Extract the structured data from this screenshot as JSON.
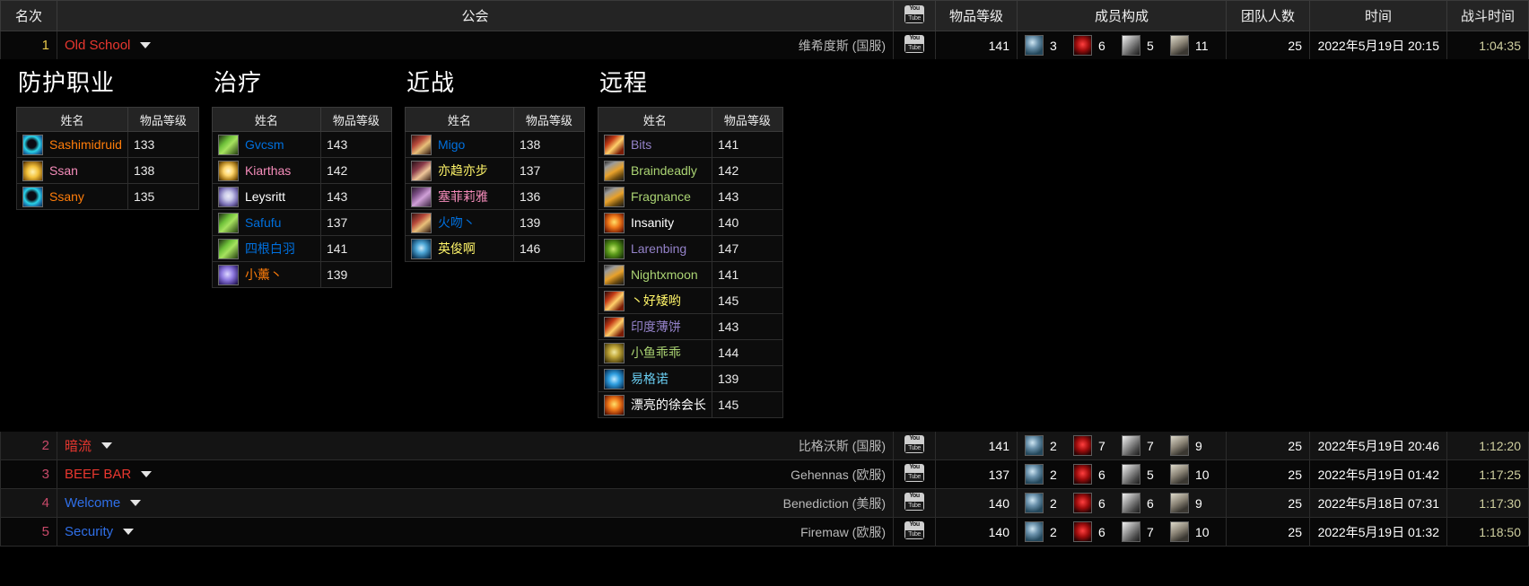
{
  "table": {
    "headers": {
      "rank": "名次",
      "guild": "公会",
      "youtube": "youtube-icon",
      "ilvl": "物品等级",
      "composition": "成员构成",
      "raid_size": "团队人数",
      "date": "时间",
      "duration": "战斗时间"
    },
    "rows": [
      {
        "rank": "1",
        "rank_color": "#e8c84a",
        "guild": "Old School",
        "guild_color": "#e8372f",
        "realm": "维希度斯 (国服)",
        "ilvl": "141",
        "comp": {
          "tank": "3",
          "healer": "6",
          "melee": "5",
          "ranged": "11"
        },
        "raid_size": "25",
        "date": "2022年5月19日 20:15",
        "duration": "1:04:35",
        "expanded": true
      },
      {
        "rank": "2",
        "rank_color": "#c94a6a",
        "guild": "暗流",
        "guild_color": "#e8372f",
        "realm": "比格沃斯 (国服)",
        "ilvl": "141",
        "comp": {
          "tank": "2",
          "healer": "7",
          "melee": "7",
          "ranged": "9"
        },
        "raid_size": "25",
        "date": "2022年5月19日 20:46",
        "duration": "1:12:20",
        "expanded": false
      },
      {
        "rank": "3",
        "rank_color": "#c94a6a",
        "guild": "BEEF BAR",
        "guild_color": "#e8372f",
        "realm": "Gehennas (欧服)",
        "ilvl": "137",
        "comp": {
          "tank": "2",
          "healer": "6",
          "melee": "5",
          "ranged": "10"
        },
        "raid_size": "25",
        "date": "2022年5月19日 01:42",
        "duration": "1:17:25",
        "expanded": false
      },
      {
        "rank": "4",
        "rank_color": "#c94a6a",
        "guild": "Welcome",
        "guild_color": "#2f6fe8",
        "realm": "Benediction (美服)",
        "ilvl": "140",
        "comp": {
          "tank": "2",
          "healer": "6",
          "melee": "6",
          "ranged": "9"
        },
        "raid_size": "25",
        "date": "2022年5月18日 07:31",
        "duration": "1:17:30",
        "expanded": false
      },
      {
        "rank": "5",
        "rank_color": "#c94a6a",
        "guild": "Security",
        "guild_color": "#2f6fe8",
        "realm": "Firemaw (欧服)",
        "ilvl": "140",
        "comp": {
          "tank": "2",
          "healer": "6",
          "melee": "7",
          "ranged": "10"
        },
        "raid_size": "25",
        "date": "2022年5月19日 01:32",
        "duration": "1:18:50",
        "expanded": false
      }
    ]
  },
  "roster": {
    "col_name": "姓名",
    "col_ilvl": "物品等级",
    "groups": [
      {
        "title": "防护职业",
        "members": [
          {
            "name": "Sashimidruid",
            "ilvl": "133",
            "cls": "druid",
            "icon": "druid"
          },
          {
            "name": "Ssan",
            "ilvl": "138",
            "cls": "pala",
            "icon": "pala"
          },
          {
            "name": "Ssany",
            "ilvl": "135",
            "cls": "druid",
            "icon": "druid"
          }
        ]
      },
      {
        "title": "治疗",
        "members": [
          {
            "name": "Gvcsm",
            "ilvl": "143",
            "cls": "shaman",
            "icon": "resto"
          },
          {
            "name": "Kiarthas",
            "ilvl": "142",
            "cls": "pala",
            "icon": "holy"
          },
          {
            "name": "Leysritt",
            "ilvl": "143",
            "cls": "priest",
            "icon": "disc"
          },
          {
            "name": "Safufu",
            "ilvl": "137",
            "cls": "shaman",
            "icon": "resto"
          },
          {
            "name": "四根白羽",
            "ilvl": "141",
            "cls": "shaman",
            "icon": "resto"
          },
          {
            "name": "小薰丶",
            "ilvl": "139",
            "cls": "druid",
            "icon": "shaman"
          }
        ]
      },
      {
        "title": "近战",
        "members": [
          {
            "name": "Migo",
            "ilvl": "138",
            "cls": "shaman",
            "icon": "warr"
          },
          {
            "name": "亦趋亦步",
            "ilvl": "137",
            "cls": "rogue",
            "icon": "fury"
          },
          {
            "name": "塞菲莉雅",
            "ilvl": "136",
            "cls": "pala",
            "icon": "rogue"
          },
          {
            "name": "火吻丶",
            "ilvl": "139",
            "cls": "shaman",
            "icon": "warr"
          },
          {
            "name": "英俊啊",
            "ilvl": "146",
            "cls": "rogue",
            "icon": "dk"
          }
        ]
      },
      {
        "title": "远程",
        "members": [
          {
            "name": "Bits",
            "ilvl": "141",
            "cls": "warl",
            "icon": "mage"
          },
          {
            "name": "Braindeadly",
            "ilvl": "142",
            "cls": "hunt",
            "icon": "warl"
          },
          {
            "name": "Fragnance",
            "ilvl": "143",
            "cls": "hunt",
            "icon": "warl"
          },
          {
            "name": "Insanity",
            "ilvl": "140",
            "cls": "priest",
            "icon": "priest"
          },
          {
            "name": "Larenbing",
            "ilvl": "147",
            "cls": "warl",
            "icon": "hunt"
          },
          {
            "name": "Nightxmoon",
            "ilvl": "141",
            "cls": "hunt",
            "icon": "warl"
          },
          {
            "name": "丶好矮哟",
            "ilvl": "145",
            "cls": "rogue",
            "icon": "mage"
          },
          {
            "name": "印度薄饼",
            "ilvl": "143",
            "cls": "warl",
            "icon": "mage"
          },
          {
            "name": "小鱼乖乖",
            "ilvl": "144",
            "cls": "hunt",
            "icon": "balance"
          },
          {
            "name": "易格诺",
            "ilvl": "139",
            "cls": "mage",
            "icon": "ele"
          },
          {
            "name": "漂亮的徐会长",
            "ilvl": "145",
            "cls": "priest",
            "icon": "priest"
          }
        ]
      }
    ]
  }
}
